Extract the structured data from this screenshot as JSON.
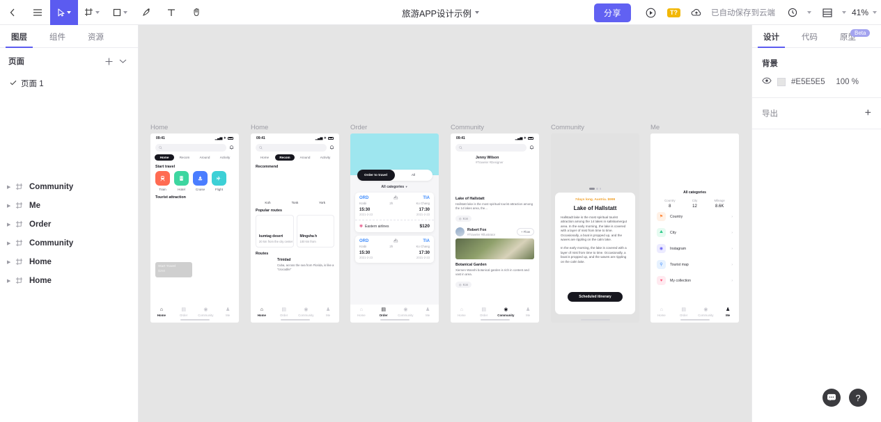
{
  "toolbar": {
    "back_icon": "chevron-left-icon",
    "menu_icon": "hamburger-menu-icon",
    "cursor_icon": "cursor-select-icon",
    "frame_icon": "frame-icon",
    "shape_icon": "rectangle-icon",
    "pen_icon": "pen-icon",
    "text_icon": "text-tool-icon",
    "hand_icon": "hand-tool-icon",
    "doc_title": "旅游APP设计示例",
    "share_label": "分享",
    "play_icon": "play-preview-icon",
    "t_badge": "T?",
    "cloud_icon": "cloud-upload-icon",
    "cloud_text": "已自动保存到云端",
    "history_icon": "history-clock-icon",
    "layout_icon": "layout-grid-icon",
    "zoom_level": "41%"
  },
  "left_panel": {
    "tabs": [
      {
        "label": "图层",
        "selected": true
      },
      {
        "label": "组件",
        "selected": false
      },
      {
        "label": "资源",
        "selected": false
      }
    ],
    "section_title": "页面",
    "add_icon": "plus-icon",
    "collapse_icon": "chevron-down-icon",
    "page_item": "页面 1",
    "check_icon": "check-icon",
    "layers": [
      {
        "label": "Community"
      },
      {
        "label": "Me"
      },
      {
        "label": "Order"
      },
      {
        "label": "Community"
      },
      {
        "label": "Home"
      },
      {
        "label": "Home"
      }
    ]
  },
  "right_panel": {
    "tabs": [
      {
        "label": "设计",
        "selected": true
      },
      {
        "label": "代码",
        "selected": false
      },
      {
        "label": "原型",
        "selected": false
      }
    ],
    "beta_badge": "Beta",
    "background_title": "背景",
    "eye_icon": "eye-icon",
    "background_hex": "#E5E5E5",
    "background_opacity": "100 %",
    "export_label": "导出",
    "export_add_icon": "plus-icon"
  },
  "floating": {
    "chat_icon": "chat-bubble-icon",
    "help_icon": "question-mark-icon"
  },
  "canvas": {
    "background_color": "#E5E5E5",
    "boards": [
      {
        "name": "Home",
        "status": {
          "time": "09:41",
          "signal": "signal-icon",
          "wifi": "wifi-icon",
          "battery": "battery-icon"
        },
        "search_placeholder": "",
        "search_icon": "search-icon",
        "bell_icon": "bell-icon",
        "tabs": [
          "Home",
          "Recom",
          "Around",
          "Activity"
        ],
        "active_tab": "Home",
        "section1": "Start travel",
        "quick_icons": [
          {
            "label": "Train",
            "glyph": "🚆",
            "color": "#FF6B52"
          },
          {
            "label": "Hotel",
            "glyph": "🏨",
            "color": "#3DD6A0"
          },
          {
            "label": "Cruise",
            "glyph": "🚢",
            "color": "#4A7DFF"
          },
          {
            "label": "Flight",
            "glyph": "✈",
            "color": "#3DD0D6"
          }
        ],
        "section2": "Tourist attraction",
        "promo_title": "Start Travel",
        "promo_price": "$260",
        "nav": [
          "Home",
          "Order",
          "Community",
          "Me"
        ],
        "nav_active": "Home"
      },
      {
        "name": "Home",
        "status": {
          "time": "09:41"
        },
        "tabs": [
          "Home",
          "Recom",
          "Around",
          "Activity"
        ],
        "active_tab": "Recom",
        "section1": "Recommend",
        "rec_items": [
          "Koh",
          "Tonk",
          "York"
        ],
        "section2": "Popular routes",
        "routes": [
          {
            "title": "kumtag desert",
            "sub": "20 km from the city center"
          },
          {
            "title": "Mingsha h",
            "sub": "100 km from"
          }
        ],
        "section3": "Routes",
        "route_post_title": "Trinidad",
        "route_post_body": "Cuba, across the sea from Florida, is like a \"crocodile\"",
        "nav": [
          "Home",
          "Order",
          "Community",
          "Me"
        ],
        "nav_active": "Home"
      },
      {
        "name": "Order",
        "hero_color": "#9EE6EF",
        "segments": [
          "Order to travel",
          "All"
        ],
        "segment_active": "Order to travel",
        "all_categories": "All categories",
        "tickets": [
          {
            "from_code": "ORD",
            "from_city": "Krabi",
            "to_code": "TIA",
            "to_city": "Ko Chang",
            "duration": "2h",
            "depart_time": "15:30",
            "depart_date": "2021-2-23",
            "arrive_time": "17:30",
            "arrive_date": "2021-2-23",
            "airline": "Eastern airlines",
            "price": "$120"
          },
          {
            "from_code": "ORD",
            "from_city": "Krabi",
            "to_code": "TIA",
            "to_city": "Ko Chang",
            "duration": "2h",
            "depart_time": "15:30",
            "depart_date": "2021-2-23",
            "arrive_time": "17:30",
            "arrive_date": "2021-2-23"
          }
        ],
        "nav": [
          "Home",
          "Order",
          "Community",
          "Me"
        ],
        "nav_active": "Order"
      },
      {
        "name": "Community",
        "status": {
          "time": "09:41"
        },
        "posts": [
          {
            "user": "Jenny Wilson",
            "tags": "#Traveler  #Designer",
            "title": "Lake of Hallstatt",
            "body": "Hallstatt lake is the most spiritual tourist attraction among the 14 lakes  area, the...",
            "chip": "Kon"
          },
          {
            "user": "Robert Fox",
            "tags": "#Traveler #Illustrator",
            "follow": "+ Flow",
            "title": "Botanical Garden",
            "body": "Xiemen Wanshi botanical garden is rich in content and vast in area.",
            "chip": "Kon"
          }
        ],
        "nav": [
          "Home",
          "Order",
          "Community",
          "Me"
        ],
        "nav_active": "Community"
      },
      {
        "name": "Community",
        "meta": "7days long. Austria. $999",
        "title": "Lake of Hallstatt",
        "paragraphs": [
          "Hallstadt lake is the most spiritual tourist attraction among the 14 lakes in saltskamergut area. In the early morning, the lake is covered with a layer of mist from time to time. Occasionally, a boat is propped up, and the waves are rippling on the calm lake.",
          "In the early morning, the lake is covered with a layer of mist from time to time. Occasionally, a boat is propped up, and the waves are rippling on the calm lake."
        ],
        "cta": "Scheduled itinerary"
      },
      {
        "name": "Me",
        "all_categories": "All categories",
        "stats": [
          {
            "key": "Country",
            "value": "8"
          },
          {
            "key": "City",
            "value": "12"
          },
          {
            "key": "Mileage",
            "value": "8.6K"
          }
        ],
        "rows": [
          {
            "label": "Country",
            "glyph": "⚑",
            "bg": "#FFF1E6",
            "fg": "#FF8A3D"
          },
          {
            "label": "City",
            "glyph": "⛰",
            "bg": "#E6FBF1",
            "fg": "#2FC98A"
          },
          {
            "label": "Instagram",
            "glyph": "◉",
            "bg": "#ECEBFF",
            "fg": "#6A63F5"
          },
          {
            "label": "Tourist map",
            "glyph": "📍",
            "bg": "#E7F2FF",
            "fg": "#3D8BFD"
          },
          {
            "label": "My collection",
            "glyph": "♥",
            "bg": "#FFEAF0",
            "fg": "#FF5577"
          }
        ],
        "arrow_icon": "chevron-right-icon",
        "nav": [
          "Home",
          "Order",
          "Community",
          "Me"
        ],
        "nav_active": "Me"
      }
    ]
  }
}
